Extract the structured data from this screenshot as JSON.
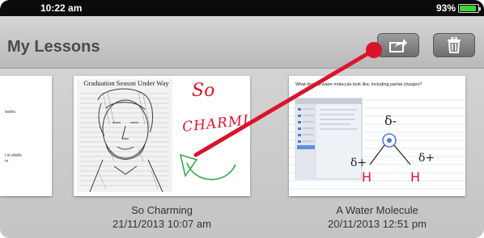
{
  "status_bar": {
    "time": "10:22 am",
    "battery": "93%",
    "battery_level": 0.93
  },
  "nav": {
    "title": "My Lessons",
    "share_icon": "share-icon",
    "trash_icon": "trash-icon"
  },
  "lessons": [
    {
      "title": "",
      "date": "",
      "snippets": [
        "works",
        "t in shells",
        "m"
      ]
    },
    {
      "title": "So Charming",
      "date": "21/11/2013 10:07 am",
      "headline": "Graduation Season Under Way",
      "handwriting": [
        "So",
        "CHARMING"
      ]
    },
    {
      "title": "A Water Molecule",
      "date": "20/11/2013 12:51 pm",
      "question": "What does a water molecule look like, including partial charges?",
      "labels": [
        "δ-",
        "δ+",
        "δ+",
        "H",
        "H"
      ]
    }
  ],
  "colors": {
    "pointer": "#d9142b",
    "battery_fill": "#3dd13a",
    "ink_red": "#d9142b",
    "ink_green": "#3aa64a"
  }
}
